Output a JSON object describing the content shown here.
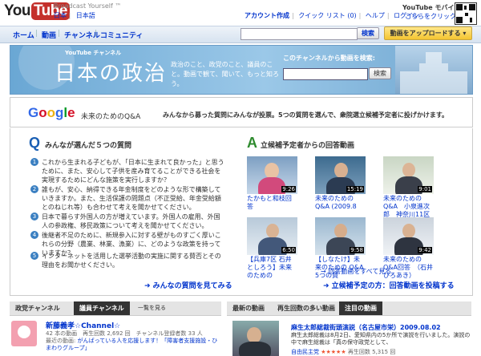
{
  "header": {
    "logo_you": "You",
    "logo_tube": "Tube",
    "tagline": "Broadcast Yourself ™",
    "lang_jp": "日本",
    "lang_ja": "日本語",
    "user_nav": [
      "アカウント作成",
      "クイック リスト (0)",
      "ヘルプ",
      "ログイン"
    ],
    "mobile_title": "YouTube モバイル",
    "mobile_link": "こちらをクリック"
  },
  "nav": {
    "tabs": [
      "ホーム",
      "動画",
      "チャンネル",
      "コミュニティ"
    ],
    "search_button": "検索",
    "upload_button": "動画をアップロードする ▾"
  },
  "banner": {
    "yt_label": "YouTube チャンネル",
    "title": "日本の政治",
    "description": "政治のこと、政党のこと、議員のこと。動画で観て、聞いて、もっと知ろう。",
    "search_label": "このチャンネルから動画を検索:",
    "search_button": "検索"
  },
  "qa": {
    "google": [
      "G",
      "o",
      "o",
      "g",
      "l",
      "e"
    ],
    "google_colors": [
      "#3369e8",
      "#d50f25",
      "#eeb211",
      "#3369e8",
      "#009925",
      "#d50f25"
    ],
    "subtitle": "未来のためのQ&A",
    "intro": "みんなから募った質問にみんなが投票。5つの質問を選んで、衆院選立候補予定者に投げかけます。",
    "q_letter": "Q",
    "q_title": "みんなが選んだ５つの質問",
    "a_letter": "A",
    "a_title": "立候補予定者からの回答動画",
    "questions": [
      {
        "num": "1",
        "text": "これから生まれる子どもが、「日本に生まれて良かった」と思うために、また、安心して子供を産み育てることができる社会を実現するためにどんな施策を実行しますか？"
      },
      {
        "num": "2",
        "text": "誰もが、安心、納得できる年金制度をどのような形で構築していきますか。また、生活保護の問題点（不正受給、年金受給額とのねじれ等）も合わせて考えを聞かせてください。"
      },
      {
        "num": "3",
        "text": "日本で暮らす外国人の方が増えています。外国人の雇用、外国人の参政権、移民政策について考えを聞かせてください。"
      },
      {
        "num": "4",
        "text": "後継者不足のために、新規参入に対する壁がものすごく厚いこれらの分野（農業、林業、漁業）に、どのような政策を持っていますか？"
      },
      {
        "num": "5",
        "text": "インターネットを活用した選挙活動の実施に関する賛否とその理由をお聞かせください。"
      }
    ],
    "see_all_questions": "➜ みんなの質問を見てみる",
    "videos": [
      {
        "duration": "9:26",
        "title": "たかもと和枝回答"
      },
      {
        "duration": "15:19",
        "title": "未来のための Q&A (2009.8"
      },
      {
        "duration": "9:01",
        "title": "未来のためのQ&A　小泉進次郎　神奈川11区"
      },
      {
        "duration": "6:50",
        "title": "【兵庫7区 石井としろう】未来のための"
      },
      {
        "duration": "9:58",
        "title": "【しなたけ】未来のための Q&A　5つの質"
      },
      {
        "duration": "9:42",
        "title": "未来のためのQ&A回答　（石井ひろあき）"
      }
    ],
    "more_answers": "→ 回答動画をすべて見る",
    "post_question": "➜ 立候補予定の方：回答動画を投稿する"
  },
  "left_panel": {
    "tabs": [
      "政党チャンネル",
      "議員チャンネル",
      "一覧を見る"
    ],
    "channel_name": "新藤義孝☆Channel☆",
    "channel_stats": "42 本の動画　再生回数 2,692 回　チャンネル登録者数 33 人",
    "recent_label": "最近の動画:",
    "recent_link": "がんばっている人を応援します！「障害者支援施設・ひまわりグループ」"
  },
  "right_panel": {
    "tabs": [
      "最新の動画",
      "再生回数の多い動画",
      "注目の動画"
    ],
    "video_title": "麻生太郎総裁街頭演説（名古屋市栄）2009.08.02",
    "video_desc": "麻生太郎総裁は8月2日、愛知県内の5か所で演説を行いました。演説の中で麻生総裁は「真の保守政党として、",
    "uploader": "自由民主党",
    "stars": "★★★★★",
    "view_count": "再生回数 5,315 回"
  },
  "colors": {
    "accent": "#0033cc",
    "tab_active": "#333333",
    "q_blue": "#1a5fb4",
    "a_green": "#2e8b2e"
  }
}
